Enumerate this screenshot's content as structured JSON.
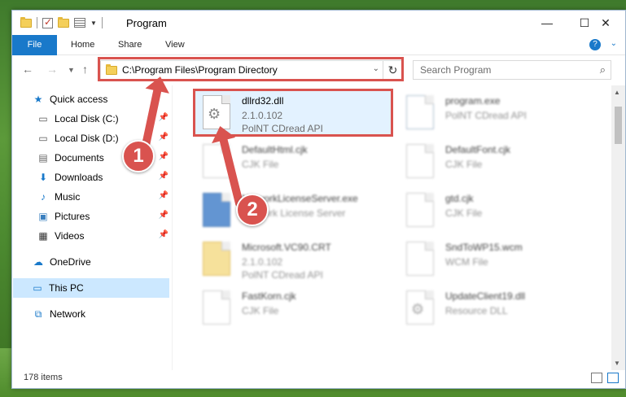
{
  "window": {
    "title": "Program"
  },
  "ribbon": {
    "tabs": [
      "File",
      "Home",
      "Share",
      "View"
    ],
    "help": "?"
  },
  "address": {
    "path": "C:\\Program Files\\Program Directory"
  },
  "search": {
    "placeholder": "Search Program"
  },
  "sidebar": {
    "items": [
      {
        "label": "Quick access",
        "icon": "star-icon"
      },
      {
        "label": "Local Disk (C:)",
        "icon": "drive-icon"
      },
      {
        "label": "Local Disk (D:)",
        "icon": "drive-icon"
      },
      {
        "label": "Documents",
        "icon": "documents-icon"
      },
      {
        "label": "Downloads",
        "icon": "download-icon"
      },
      {
        "label": "Music",
        "icon": "music-icon"
      },
      {
        "label": "Pictures",
        "icon": "pictures-icon"
      },
      {
        "label": "Videos",
        "icon": "videos-icon"
      },
      {
        "label": "OneDrive",
        "icon": "cloud-icon"
      },
      {
        "label": "This PC",
        "icon": "computer-icon"
      },
      {
        "label": "Network",
        "icon": "network-icon"
      }
    ]
  },
  "files": [
    {
      "name": "dllrd32.dll",
      "line2": "2.1.0.102",
      "line3": "PolNT CDread API"
    },
    {
      "name": "program.exe",
      "line2": "PolNT CDread API",
      "line3": ""
    },
    {
      "name": "DefaultHtml.cjk",
      "line2": "CJK File",
      "line3": ""
    },
    {
      "name": "DefaultFont.cjk",
      "line2": "CJK File",
      "line3": ""
    },
    {
      "name": "NetworkLicenseServer.exe",
      "line2": "Network License Server",
      "line3": ""
    },
    {
      "name": "gtd.cjk",
      "line2": "CJK File",
      "line3": ""
    },
    {
      "name": "Microsoft.VC90.CRT",
      "line2": "2.1.0.102",
      "line3": "PolNT CDread API"
    },
    {
      "name": "SndToWP15.wcm",
      "line2": "WCM File",
      "line3": ""
    },
    {
      "name": "FastKorn.cjk",
      "line2": "CJK File",
      "line3": ""
    },
    {
      "name": "UpdateClient19.dll",
      "line2": "Resource DLL",
      "line3": ""
    }
  ],
  "callouts": [
    "1",
    "2"
  ],
  "status": {
    "items": "178 items"
  },
  "colors": {
    "accent": "#1979ca",
    "highlight": "#d9534f",
    "selection": "#cce8ff"
  }
}
